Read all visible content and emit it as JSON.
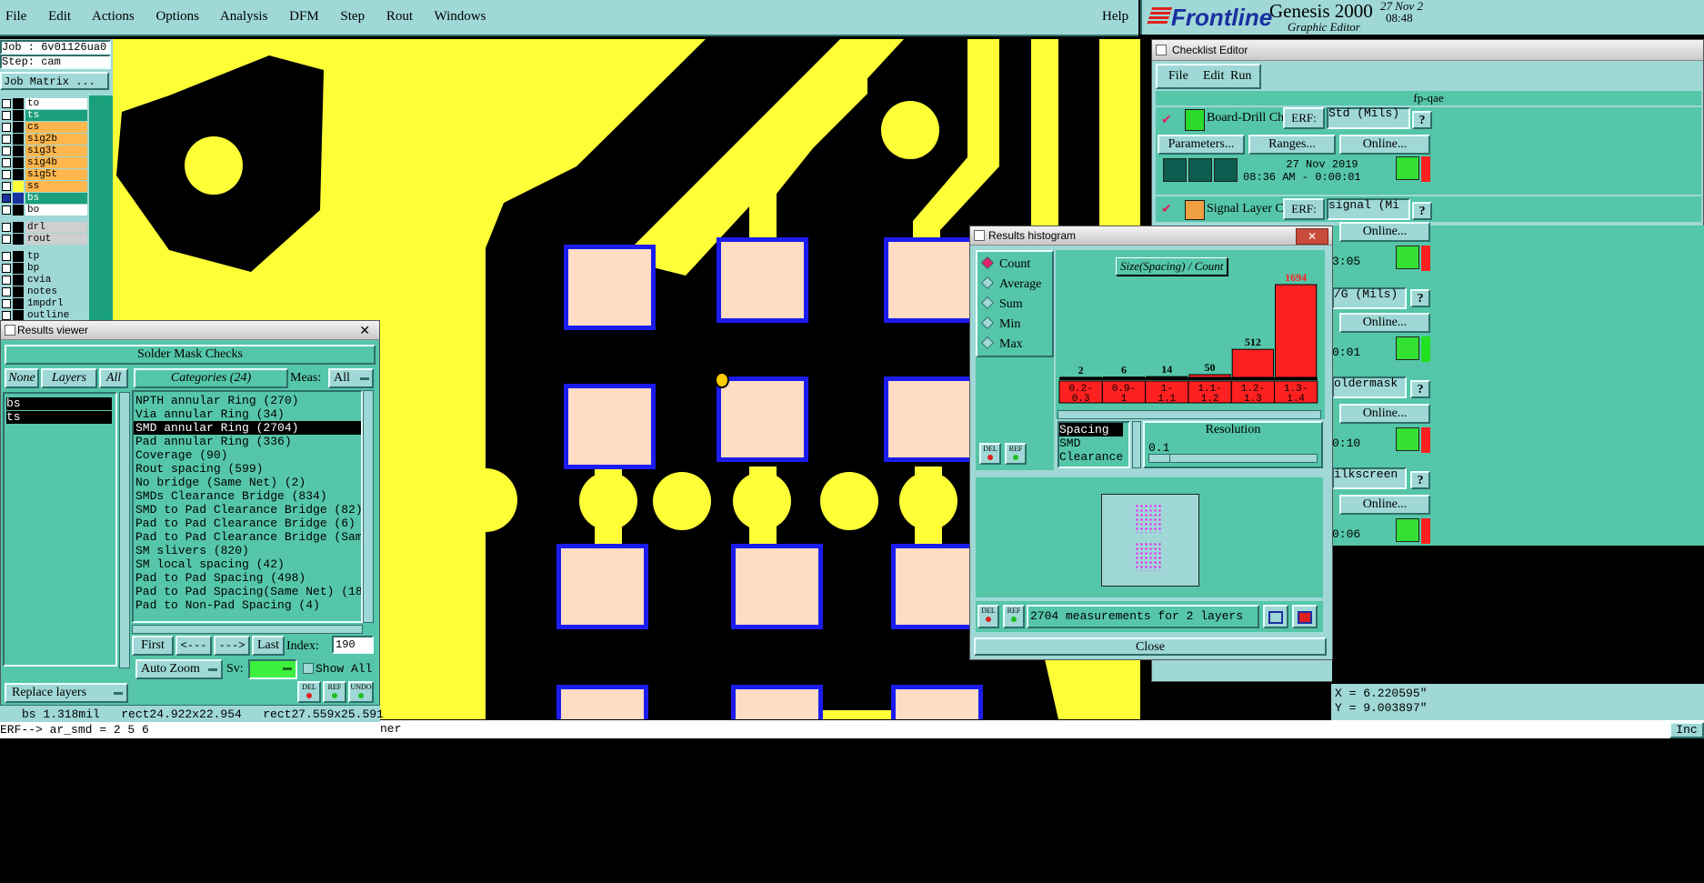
{
  "menubar": {
    "items": [
      "File",
      "Edit",
      "Actions",
      "Options",
      "Analysis",
      "DFM",
      "Step",
      "Rout",
      "Windows"
    ],
    "help": "Help"
  },
  "brand": {
    "logo": "Frontline",
    "product": "Genesis 2000",
    "subtitle": "Graphic Editor",
    "date": "27 Nov 2",
    "time": "08:48"
  },
  "job_panel": {
    "job": "Job : 6v01126ua0",
    "step": "Step: cam",
    "matrix_button": "Job Matrix ..."
  },
  "layers": [
    {
      "name": "to",
      "color": "#ffffff"
    },
    {
      "name": "ts",
      "color": "#1aa07a"
    },
    {
      "name": "cs",
      "color": "#ffb74d"
    },
    {
      "name": "sig2b",
      "color": "#ffb74d"
    },
    {
      "name": "sig3t",
      "color": "#ffb74d"
    },
    {
      "name": "sig4b",
      "color": "#ffb74d"
    },
    {
      "name": "sig5t",
      "color": "#ffb74d"
    },
    {
      "name": "ss",
      "color": "#ffb74d"
    },
    {
      "name": "bs",
      "color": "#1aa07a"
    },
    {
      "name": "bo",
      "color": "#ffffff"
    },
    {
      "name": "drl",
      "color": "#cfcfcf"
    },
    {
      "name": "rout",
      "color": "#cfcfcf"
    },
    {
      "name": "tp",
      "color": "#9fd8d6"
    },
    {
      "name": "bp",
      "color": "#9fd8d6"
    },
    {
      "name": "cvia",
      "color": "#9fd8d6"
    },
    {
      "name": "notes",
      "color": "#9fd8d6"
    },
    {
      "name": "1mpdrl",
      "color": "#9fd8d6"
    },
    {
      "name": "outline",
      "color": "#9fd8d6"
    }
  ],
  "results_viewer": {
    "title": "Results viewer",
    "header": "Solder Mask Checks",
    "none_btn": "None",
    "layers_btn": "Layers",
    "all_btn": "All",
    "categories_label": "Categories (24)",
    "meas_label": "Meas:",
    "meas_value": "All",
    "layer_list": [
      "bs",
      "ts"
    ],
    "categories": [
      "NPTH annular Ring (270)",
      "Via annular Ring (34)",
      "SMD annular Ring (2704)",
      "Pad annular Ring (336)",
      "Coverage (90)",
      "Rout spacing (599)",
      "No bridge (Same Net) (2)",
      "SMDs Clearance Bridge (834)",
      "SMD to Pad Clearance Bridge (82)",
      "Pad to Pad Clearance Bridge (6)",
      "Pad to Pad Clearance Bridge (Same",
      "SM slivers (820)",
      "SM local spacing (42)",
      "Pad to Pad Spacing (498)",
      "Pad to Pad Spacing(Same Net) (18)",
      "Pad to Non-Pad Spacing (4)"
    ],
    "selected_index": 2,
    "first_btn": "First",
    "prev_btn": "<---",
    "next_btn": "--->",
    "last_btn": "Last",
    "index_label": "Index:",
    "index_value": "190",
    "replace_layers": "Replace layers",
    "auto_zoom": "Auto Zoom",
    "sv_label": "Sv:",
    "show_all": "Show All",
    "del": "DEL",
    "ref": "REF",
    "undo": "UNDO"
  },
  "status": {
    "measure": "bs 1.318mil   rect24.922x22.954   rect27.559x25.591",
    "command": "ERF--> ar_smd = 2 5 6",
    "right_text": "ner",
    "coord_x": "X = 6.220595\"",
    "coord_y": "Y = 9.003897\"",
    "inch": "Inc"
  },
  "checklist": {
    "title": "Checklist Editor",
    "menu": [
      "File",
      "Edit",
      "Run"
    ],
    "name": "fp-qae",
    "check1_label": "Board-Drill Che",
    "erf_label": "ERF:",
    "check1_erf": "Std (Mils)",
    "parameters_btn": "Parameters...",
    "ranges_btn": "Ranges...",
    "online_btn": "Online...",
    "run_date": "27 Nov 2019",
    "run_time": "08:36 AM - 0:00:01",
    "check2_label": "Signal Layer Ch",
    "check2_erf": "signal (Mi",
    "side_times": [
      "3:05",
      "0:01",
      "0:10",
      "0:06"
    ],
    "side_erfs": [
      "/G (Mils)",
      "oldermask",
      "ilkscreen"
    ],
    "question": "?"
  },
  "histogram": {
    "title": "Results histogram",
    "modes": [
      "Count",
      "Average",
      "Sum",
      "Min",
      "Max"
    ],
    "selected_mode": "Count",
    "del": "DEL",
    "ref": "REF",
    "summary": "2704 measurements for 2 layers",
    "close_btn": "Close",
    "measures": [
      "Spacing",
      "SMD",
      "Clearance"
    ],
    "selected_measure": "Spacing",
    "resolution_label": "Resolution",
    "resolution_value": "0.1"
  },
  "chart_data": {
    "type": "bar",
    "title": "Size(Spacing) / Count",
    "categories": [
      "0.2-0.3",
      "0.9-1",
      "1-1.1",
      "1.1-1.2",
      "1.2-1.3",
      "1.3-1.4"
    ],
    "category_labels": [
      [
        "0.2-",
        "0.3"
      ],
      [
        "0.9-",
        "1"
      ],
      [
        "1-",
        "1.1"
      ],
      [
        "1.1-",
        "1.2"
      ],
      [
        "1.2-",
        "1.3"
      ],
      [
        "1.3-",
        "1.4"
      ]
    ],
    "values": [
      2,
      6,
      14,
      50,
      512,
      1694
    ],
    "ylim": [
      0,
      1694
    ],
    "bar_color": "#ff2020",
    "max_label_color": "#ff2020"
  }
}
